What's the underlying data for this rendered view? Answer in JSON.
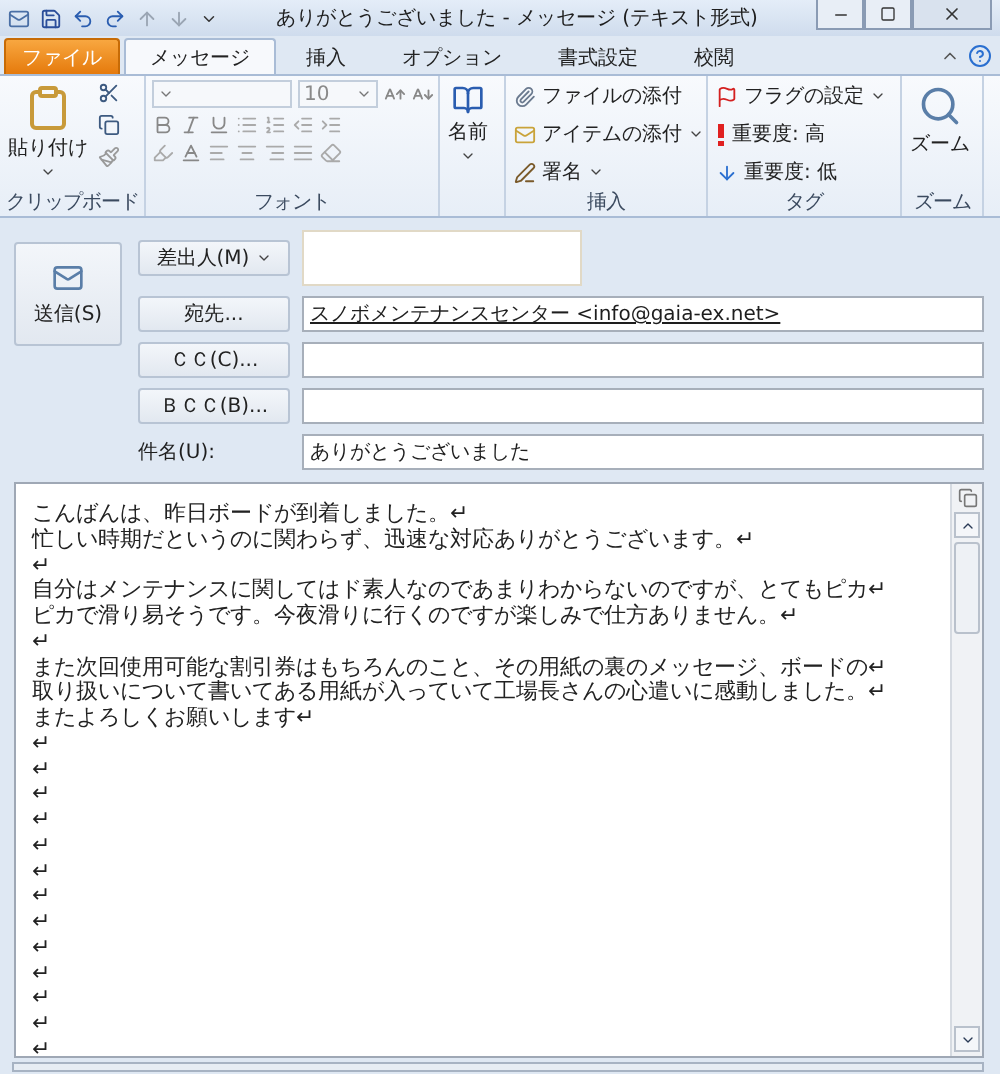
{
  "window": {
    "title": "ありがとうございました - メッセージ (テキスト形式)"
  },
  "file_tab": "ファイル",
  "tabs": [
    {
      "label": "メッセージ",
      "selected": true
    },
    {
      "label": "挿入",
      "selected": false
    },
    {
      "label": "オプション",
      "selected": false
    },
    {
      "label": "書式設定",
      "selected": false
    },
    {
      "label": "校閲",
      "selected": false
    }
  ],
  "ribbon": {
    "clipboard": {
      "label": "クリップボード",
      "paste": "貼り付け"
    },
    "font": {
      "label": "フォント",
      "size": "10"
    },
    "names": {
      "button": "名前"
    },
    "insert": {
      "label": "挿入",
      "items": [
        {
          "label": "ファイルの添付",
          "dropdown": false
        },
        {
          "label": "アイテムの添付",
          "dropdown": true
        },
        {
          "label": "署名",
          "dropdown": true
        }
      ]
    },
    "tags": {
      "label": "タグ",
      "items": [
        {
          "label": "フラグの設定",
          "dropdown": true
        },
        {
          "label": "重要度: 高",
          "dropdown": false
        },
        {
          "label": "重要度: 低",
          "dropdown": false
        }
      ]
    },
    "zoom": {
      "label": "ズーム",
      "button": "ズーム"
    }
  },
  "header": {
    "send": "送信(S)",
    "from": "差出人(M)",
    "fields": [
      {
        "kind": "button",
        "label": "宛先...",
        "value": "スノボメンテナンスセンター <info@gaia-ex.net>"
      },
      {
        "kind": "button",
        "label": "ＣＣ(C)..."
      },
      {
        "kind": "button",
        "label": "ＢＣＣ(B)..."
      },
      {
        "kind": "label",
        "label": "件名(U):",
        "value": "ありがとうございました"
      }
    ]
  },
  "body": {
    "lines": [
      "こんばんは、昨日ボードが到着しました。↵",
      "忙しい時期だというのに関わらず、迅速な対応ありがとうございます。↵",
      "↵",
      "自分はメンテナンスに関してはド素人なのであまりわからないのですが、とてもピカ↵",
      "ピカで滑り易そうです。今夜滑りに行くのですが楽しみで仕方ありません。↵",
      "↵",
      "また次回使用可能な割引券はもちろんのこと、その用紙の裏のメッセージ、ボードの↵",
      "取り扱いについて書いてある用紙が入っていて工場長さんの心遣いに感動しました。↵",
      "またよろしくお願いします↵",
      "↵",
      "↵",
      "↵",
      "↵",
      "↵",
      "↵",
      "↵",
      "↵",
      "↵",
      "↵",
      "↵",
      "↵",
      "↵"
    ]
  }
}
